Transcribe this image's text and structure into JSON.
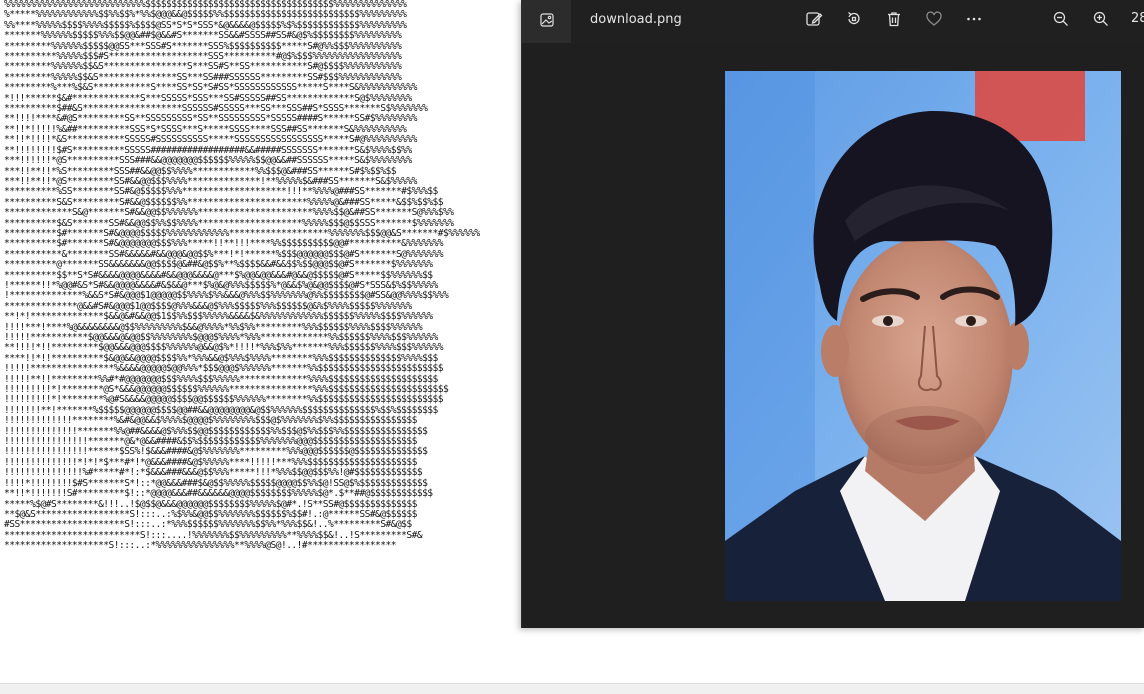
{
  "viewer": {
    "filename": "download.png",
    "zoom_level": "28"
  },
  "toolbar": {
    "app_icon": "image-icon",
    "edit_icon": "edit-image-icon",
    "rotate_icon": "rotate-icon",
    "delete_icon": "trash-icon",
    "favorite_icon": "heart-icon",
    "more_icon": "more-dots-icon",
    "zoom_out_icon": "zoom-out-icon",
    "zoom_in_icon": "zoom-in-icon"
  },
  "colors": {
    "viewer_bg": "#1f1f1f",
    "toolbar_bg": "#202020",
    "photo_bg": "#6fa7e6",
    "accent_red": "#e0453a"
  },
  "ascii_art": [
    "%%%%%%%%%%%%%%%%%%%%%%%%%%%$$$$$$$$$$$$$$$$$$$$$$$$$$$$$$$$$$$$%%%%%%%%%%%%%%",
    "%*****%%%%%%%%%%%%$$%%$$%*%%$@@@&&@$$$$$%%$$$$$$$$$$$$$$$$$$$$$$$$$$%%%%%%%%%",
    "%%****%%%%%$$$$%%%%$$$$$%$$$$@SS*S*S*SSS*&@&&&&@$$$$$%$%$$$$$$$$$$$$%%%%%%%%%",
    "*******%%%%%%$$$$$%%%$$@@&##$@&&#S*******SS&&#SSSS##SS#&@$%$$$$$$$$%%%%%%%%%",
    "*********%%%%%%$$$$$@@SS***SSS#S*******SSS%$$$$$$$$$$*****S#@%%$$$%%%%%%%%%%",
    "**********%%%%%$$$#S*******************SSS**********#@$%$$$%%%%%%%%%%%%%%%%%",
    "*********%%%%%%$$&S****************S***SS#S**SS***********S#@$$$$%%%%%%%%%%%",
    "*********%%%%%$$&S***************SS***SS###SSSSSS*********SS#$$$%%%%%%%%%%%%",
    "*********%***%$&S***********S****SS*SS*S#SS*SSSSSSSSSSSS*****S****S&%%%%%%%%%%%",
    "*!!!******$&#*************S***SSSSS*SSS***SS#SSSSS##SS*************S@$%%%%%%%%",
    "**********$##&S*******************SSSSSS#SSSSS***SS***SSS##S*SSSS*******S$%%%%%%%",
    "**!!!!****&#@S*********SS**SSSSSSSSS*SS**SSSSSSSSS*SSSSS####S******SS#$%%%%%%%%",
    "**!!*!!!!!%&##**********SSS*S*SSSS***S*****SSSS****SSS##SS*******S&%%%%%%%%%%",
    "**!!*!!!!*&S***********SSSSS#SSSSSSSSSS*****SSSSSSSSSSSSSSSSS*****S#@%%%%%%%%%%",
    "**!!!!!!!!$#S**********SSSSS##################&&#####SSSSSSS*******S&$%%%%$$%%",
    "***!!!!!!*@S**********SSS###&&@@@@@@@$$$$$$%%%%%$$@@&&##SSSSSS*****S&$%%%%%%%%",
    "***!!**!!*%S*********SSS##&&@@$$%%%%************%%$$$@&###SS******S#$%$$%$$",
    "***!!**!!*@S*********SS#&&@@$$$%%%%**************!**%%%%%$&###SS*******S&$%%%%%",
    "**********%SS********SS#&@$$$$$%%%********************!!!**%%%%@###SS*******#$%%%$$",
    "**********S&S*********S#&&@$$$$$$%%***********************%%%%%@&###SS*****&$$%$$%$$",
    "*************S&@*******S#&&@@$$%%%%%%**********************%%%%$$@&##SS*******S@%%%$%%",
    "**********$&S*******SS#&&@@$$%%$$%%%%********************%%%%%$$$@$$SSS*******$%%%%%%%",
    "**********$#*******S#&@@@@$$$$$%%%%%%%%%%%%*******************%%%%%%%$$$@@&S*******#$%%%%%%",
    "**********$#*******S#&@@@@@@@$$$%%%*****!!**!!!****%%$$$$$$$$$$@@#**********&%%%%%%%",
    "***********&********SS#&&&&&#&&@@@&@@$$%***!*!******%$$$@@@@@@$$$@#S*******S@%%%%%%%",
    "**********@*******SS&&&&&&&@@$$$$@&##&@$$%**%$$$$&&#&&$$%$$@@@$$@#S*******$%%%%%%%",
    "**********$$**S*S#&&&&@@@@&&&&#&&@@@&&&&@***$%@@&@@&&&#@&&@$$$$$@#S*****$$%%%%%%$$",
    "!******!!*%@@#&S*S#&&@@@@&&&&#&$&&@***$%@&@%%%$$$$$%*@&&$%@&@@$$$$@#S*SSS&$%$$%%%%%",
    "!**************%&&S*S#&@@@$1@@@@@$$%%%%$%%&&&@%%%$$%%%%%%%@%%$$$$$$$$@#SS&@@%%%%$$%%%",
    "**************@&&#S#&@@@$1@@$$$$@%%%&&&@$%%%$$$$$%%%$$$$$$@&%$%%%%$$$$$%%%%%%%",
    "**!*!**************$&&@&#&&@@$1$$%%$$$%%%%%&&&&$&%%%%%%%%%%%%$$$$$$%%%%%$$$$%%%%%%",
    "!!!!***!****%@&&&&&&&&@$$%%%%%%%%%$&&@%%%%*%%$%%*********%%%$$$$$$%%%%$$$$%%%%%%",
    "!!!!!***********$@@&&&@&@@$$%%%%%%%%$@@@$%%%%*%%%*************%%$$$$$$%%%%$$$%%%%%%",
    "**!!!!*!!*********$@@&&&@@@$$$$%%%%%%@&&@$%*!!!!*%%%$%%*******%%%$$$$$$%%%%$$$%%%%%%",
    "****!!*!!**********$&@@&&@@@@$$$$%%*%%%&&@$%%%$%%%%********%%%$$$$$$$$$$$$$$%%%%$$$",
    "!!!!!****************%&&&&@@@@@$@@%%%*$$$@@@$%%%%%%*******%%$$$$$$$$$$$$$$$$$$$$$$$$",
    "!!!!!**!!*********%%#*#@@@@@@@$$$%%%%$$$%%%%%*************%%%%$$$$$$$$$$$$$$$$$$$$$",
    "!!!!!!!!!*!********@S*&&&@@@@@@$$$$$$%%%%%%****************%%%$$$$$$$$$$$$$$$$$$$$$$$",
    "!!!!!!!!!*!********%@#S&&&&@@@@@$$$$@@$$$$$$%%%%%%********%%$$$$$$$$$$$$$$$$$$$$$$$$",
    "!!!!!!!**!*******%$$$$$@@@@@@$$$$@@##&&@@@@@@@@&@$$%%%%%%$$$$$$$$$$$$$$%$$%$$$$$$$$",
    "!!!!!!!!!!!!!********%&#&@@&&$%%%%$@@@@$%%%%%%%%$$$@$%%%%%%%$%%$$$$$$$$$$$$$$$$",
    "!!!!!!!!!!!!!!*******%%@##&&&&@$%%%$$@@$$$$$$$$$$$$%%$$$@$%%$$$%%$$$$$$$$$$$$$$$$",
    "!!!!!!!!!!!!!!!!*******@&*@&&####&$$%$$$$$$$$$$$$%%%%%%%@@@$$$$$$$$$$$$$$$$$$$$",
    "!!!!!!!!!!!!!!!!******$SS%!$&&&####&@$%%%%%%%*********%%%@@@$$$$$$@$$$$$$$$$$$$$$",
    "!!!!!!!!!!!!!!*!*!*$***#*!*@&&&####&@$%%%%%****!!!!!***%%%$$$$$$$$$$$$$$$$$$$$$",
    "!!!!!!!!!!!!!!!%#*****#*!:*$&&&###&&&@$$%%%*****!!!*%%%$$@@$$$%%!@#$$$$$$$$$$$$$",
    "!!!!*!!!!!!!!$#S*******S*!::*@@&&&###$&@$$%%%%%$$$$$@@@@$$%%$@!SS@$%$$$$$$$$$$$$$",
    "**!!*!!!!!!!S#*********$!::*@@@@&&&##&&&&&&@@@@$$$$$$$$%%%%%$@*.$**##@$$$$$$$$$$$$",
    "*****%$@#S********&!!!..!$@$$@&&&@@@@@@$$$$$$$$%%%%%$@#*.!S**SS#@$$$$$$$$$$$$$$",
    "**$@&S******************S!:::..:%$%%&@@$$%%%%%%%$$$$$$%$$#!.:@******SS#&@$$$$$$",
    "#SS********************S!:::..:*%%%$$$$$$%%%%%%%$$%%*%%%$$&!..%*********S#&@$$",
    "**************************S!:::....!%%%%%%%$$%%%%%%%%%**%%%%$$&!..!S*********S#&",
    "********************S!:::..:*%%%%%%%%%%%%%%%**%%%%@S@!..!#*****************"
  ]
}
